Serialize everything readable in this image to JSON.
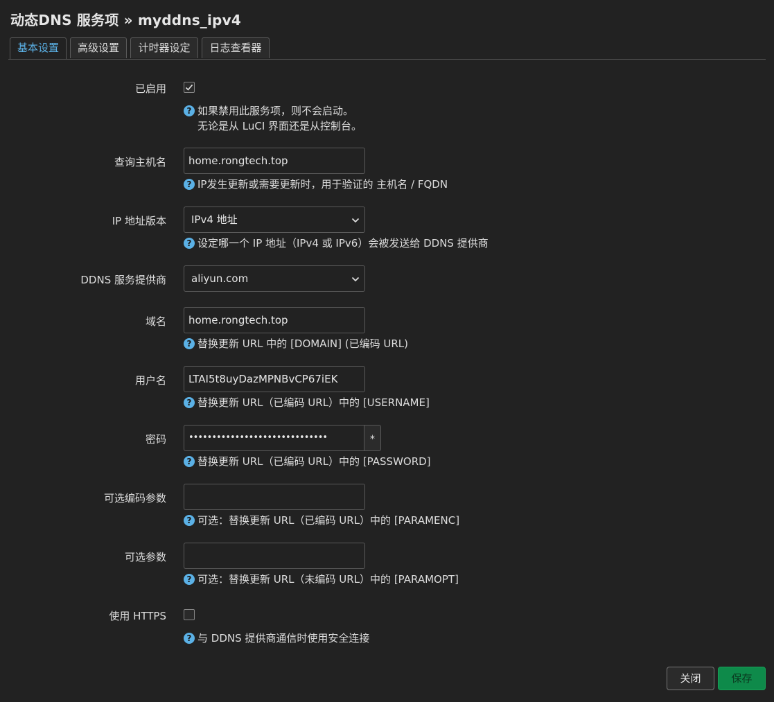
{
  "page": {
    "title": "动态DNS 服务项 » myddns_ipv4"
  },
  "tabs": [
    {
      "label": "基本设置",
      "active": true
    },
    {
      "label": "高级设置",
      "active": false
    },
    {
      "label": "计时器设定",
      "active": false
    },
    {
      "label": "日志查看器",
      "active": false
    }
  ],
  "fields": {
    "enabled": {
      "label": "已启用",
      "checked": true,
      "help_line1": "如果禁用此服务项，则不会启动。",
      "help_line2": "无论是从 LuCI 界面还是从控制台。"
    },
    "lookup_host": {
      "label": "查询主机名",
      "value": "home.rongtech.top",
      "help": "IP发生更新或需要更新时，用于验证的 主机名 / FQDN"
    },
    "ip_version": {
      "label": "IP 地址版本",
      "selected": "IPv4 地址",
      "help": "设定哪一个 IP 地址（IPv4 或 IPv6）会被发送给 DDNS 提供商"
    },
    "service": {
      "label": "DDNS 服务提供商",
      "selected": "aliyun.com"
    },
    "domain": {
      "label": "域名",
      "value": "home.rongtech.top",
      "help": "替换更新 URL 中的 [DOMAIN] (已编码 URL)"
    },
    "username": {
      "label": "用户名",
      "value": "LTAI5t8uyDazMPNBvCP67iEK",
      "help": "替换更新 URL（已编码 URL）中的 [USERNAME]"
    },
    "password": {
      "label": "密码",
      "masked_value": "••••••••••••••••••••••••••••••",
      "reveal_label": "*",
      "help": "替换更新 URL（已编码 URL）中的 [PASSWORD]"
    },
    "param_enc": {
      "label": "可选编码参数",
      "value": "",
      "help": "可选：替换更新 URL（已编码 URL）中的 [PARAMENC]"
    },
    "param_opt": {
      "label": "可选参数",
      "value": "",
      "help": "可选：替换更新 URL（未编码 URL）中的 [PARAMOPT]"
    },
    "use_https": {
      "label": "使用 HTTPS",
      "checked": false,
      "help": "与 DDNS 提供商通信时使用安全连接"
    }
  },
  "help_icon_glyph": "?",
  "buttons": {
    "close": "关闭",
    "save": "保存"
  },
  "colors": {
    "background": "#222222",
    "accent": "#5bb1e6",
    "save_button": "#0e8a4a"
  }
}
